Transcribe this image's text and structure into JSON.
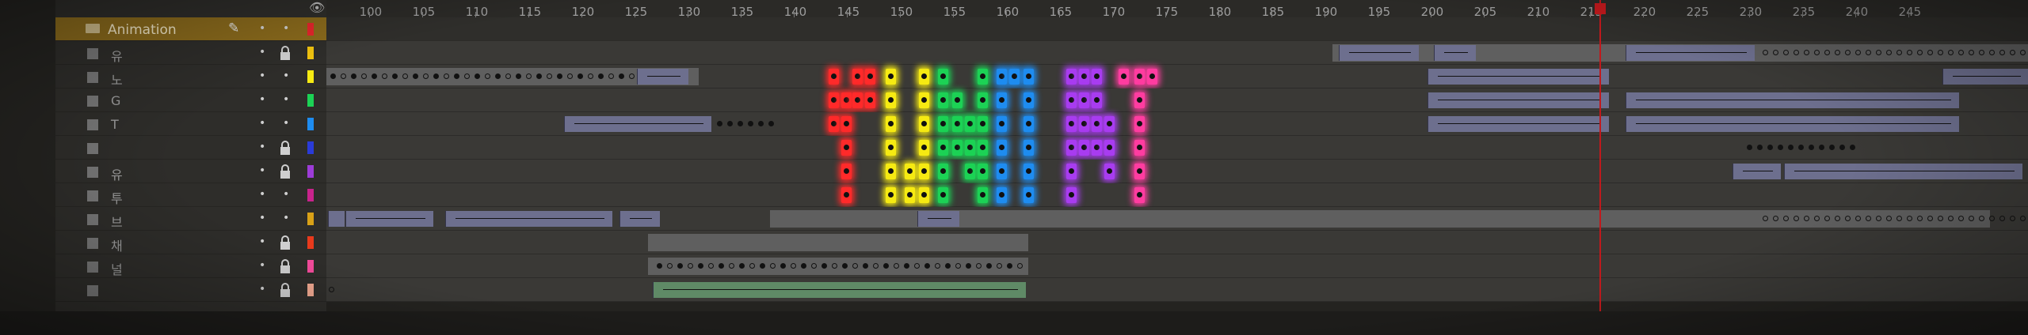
{
  "header": {
    "icons": [
      "eye-icon",
      "lock-icon",
      "outline-icon"
    ]
  },
  "ruler": {
    "labels": [
      "100",
      "105",
      "110",
      "115",
      "120",
      "125",
      "130",
      "135",
      "140",
      "145",
      "150",
      "155",
      "160",
      "165",
      "170",
      "175",
      "180",
      "185",
      "190",
      "195",
      "200",
      "205",
      "210",
      "215",
      "220",
      "225",
      "230",
      "235",
      "240",
      "245"
    ],
    "playhead_frame": 216
  },
  "layers": [
    {
      "name": "Animation",
      "folder": true,
      "color": "#e6262c"
    },
    {
      "name": "유",
      "color": "#f2c40f"
    },
    {
      "name": "노",
      "color": "#f6ea12"
    },
    {
      "name": "G",
      "color": "#1cd255"
    },
    {
      "name": "T",
      "color": "#1e8cf0"
    },
    {
      "name": "",
      "color": "#2a3bd8"
    },
    {
      "name": "유",
      "color": "#9d3cd8"
    },
    {
      "name": "투",
      "color": "#c8238c"
    },
    {
      "name": "브",
      "color": "#d9a117"
    },
    {
      "name": "채",
      "color": "#e83a1c"
    },
    {
      "name": "널",
      "color": "#f24b9a"
    },
    {
      "name": "",
      "color": "#f0a890"
    }
  ],
  "colors": {
    "folder_row": "#8a6a1c",
    "tween": "#6d6f8e",
    "playhead": "#c0191c"
  }
}
